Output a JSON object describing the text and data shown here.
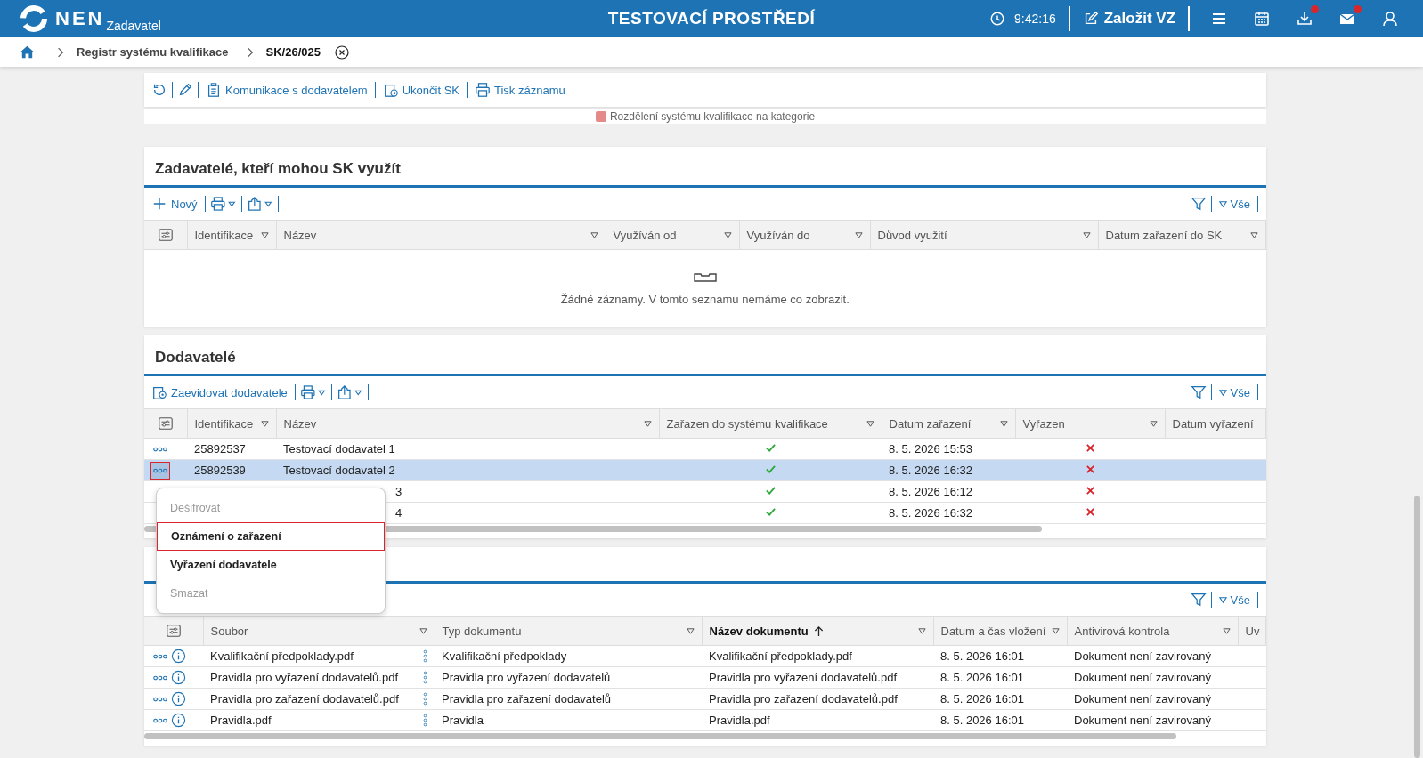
{
  "header": {
    "app": "NEN",
    "role": "Zadavatel",
    "environment": "TESTOVACÍ PROSTŘEDÍ",
    "time": "9:42:16",
    "create_label": "Založit VZ",
    "notifications": [
      {
        "kind": "download",
        "badge": true
      },
      {
        "kind": "mail",
        "badge": true
      }
    ]
  },
  "breadcrumb": [
    {
      "label": "Registr systému kvalifikace",
      "current": false
    },
    {
      "label": "SK/26/025",
      "current": true
    }
  ],
  "toolbar": [
    {
      "kind": "refresh"
    },
    {
      "kind": "edit"
    },
    {
      "kind": "clipboard",
      "label": "Komunikace s dodavatelem"
    },
    {
      "kind": "finish",
      "label": "Ukončit SK"
    },
    {
      "kind": "print",
      "label": "Tisk záznamu"
    }
  ],
  "category_note": "Rozdělení systému kvalifikace na kategorie",
  "contracting_authorities": {
    "title": "Zadavatelé, kteří mohou SK využít",
    "primary": {
      "kind": "add",
      "label": "Nový"
    },
    "filter_label": "Vše",
    "columns": [
      "Identifikace",
      "Název",
      "Využíván od",
      "Využíván do",
      "Důvod využití",
      "Datum zařazení do SK"
    ],
    "empty_text": "Žádné záznamy. V tomto seznamu nemáme co zobrazit."
  },
  "suppliers": {
    "title": "Dodavatelé",
    "primary": {
      "kind": "register",
      "label": "Zaevidovat dodavatele"
    },
    "filter_label": "Vše",
    "columns": [
      "Identifikace",
      "Název",
      "Zařazen do systému kvalifikace",
      "Datum zařazení",
      "Vyřazen",
      "Datum vyřazení"
    ],
    "rows": [
      {
        "id": "25892537",
        "name": "Testovací dodavatel 1",
        "included": true,
        "excluded": false,
        "date": "8. 5. 2026 15:53",
        "selected": false,
        "covered": false
      },
      {
        "id": "25892539",
        "name": "Testovací dodavatel 2",
        "included": true,
        "excluded": false,
        "date": "8. 5. 2026 16:32",
        "selected": true,
        "covered": false
      },
      {
        "name": "3",
        "included": true,
        "excluded": false,
        "date": "8. 5. 2026 16:12",
        "selected": false,
        "covered": true
      },
      {
        "name": "4",
        "included": true,
        "excluded": false,
        "date": "8. 5. 2026 16:32",
        "selected": false,
        "covered": true
      }
    ]
  },
  "context_menu": [
    {
      "label": "Dešifrovat",
      "disabled": true,
      "selected": false
    },
    {
      "label": "Oznámení o zařazení",
      "disabled": false,
      "selected": true
    },
    {
      "label": "Vyřazení dodavatele",
      "disabled": false,
      "selected": false
    },
    {
      "label": "Smazat",
      "disabled": true,
      "selected": false
    }
  ],
  "documents": {
    "filter_label": "Vše",
    "columns": [
      {
        "label": "Soubor",
        "sorted": false
      },
      {
        "label": "Typ dokumentu",
        "sorted": false
      },
      {
        "label": "Název dokumentu",
        "sorted": true
      },
      {
        "label": "Datum a čas vložení",
        "sorted": false
      },
      {
        "label": "Antivirová kontrola",
        "sorted": false
      },
      {
        "label": "Uv",
        "sorted": false
      }
    ],
    "rows": [
      {
        "file": "Kvalifikační předpoklady.pdf",
        "type": "Kvalifikační předpoklady",
        "name": "Kvalifikační předpoklady.pdf",
        "date": "8. 5. 2026 16:01",
        "antivirus": "Dokument není zavirovaný"
      },
      {
        "file": "Pravidla pro vyřazení dodavatelů.pdf",
        "type": "Pravidla pro vyřazení dodavatelů",
        "name": "Pravidla pro vyřazení dodavatelů.pdf",
        "date": "8. 5. 2026 16:01",
        "antivirus": "Dokument není zavirovaný"
      },
      {
        "file": "Pravidla pro zařazení dodavatelů.pdf",
        "type": "Pravidla pro zařazení dodavatelů",
        "name": "Pravidla pro zařazení dodavatelů.pdf",
        "date": "8. 5. 2026 16:01",
        "antivirus": "Dokument není zavirovaný"
      },
      {
        "file": "Pravidla.pdf",
        "type": "Pravidla",
        "name": "Pravidla.pdf",
        "date": "8. 5. 2026 16:01",
        "antivirus": "Dokument není zavirovaný"
      }
    ]
  }
}
